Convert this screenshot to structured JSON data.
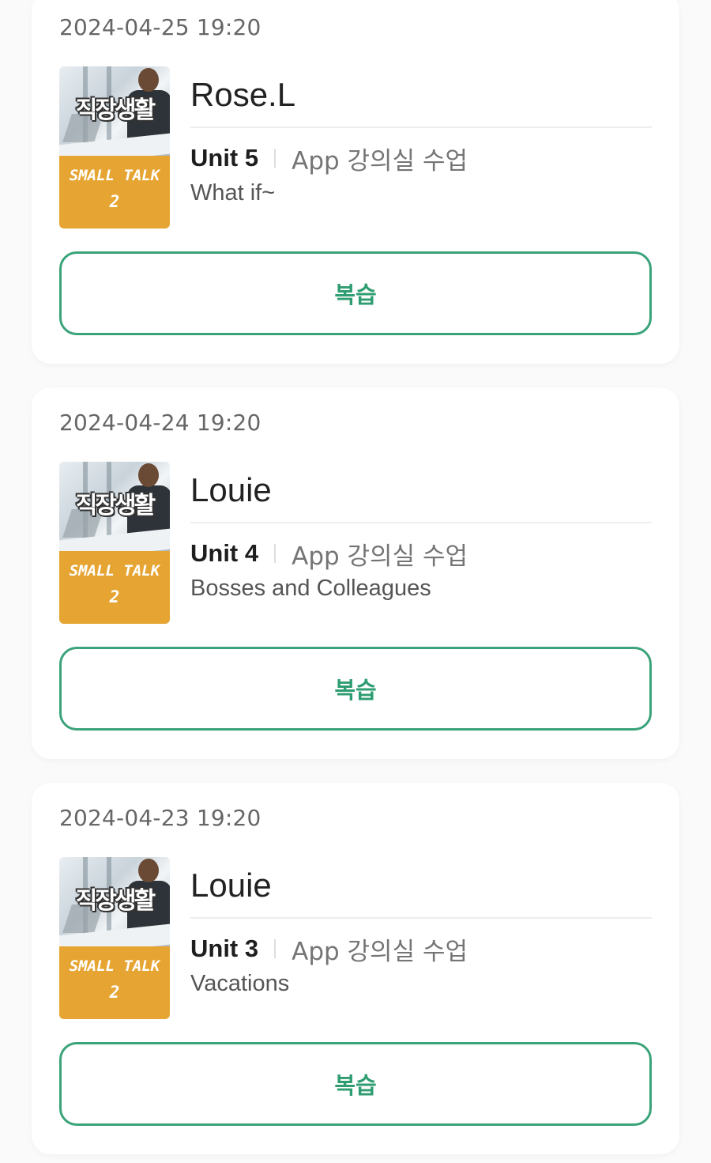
{
  "lessons": [
    {
      "date": "2024-04-25 19:20",
      "thumbnail": {
        "title": "직장생활",
        "subtitle": "SMALL TALK",
        "number": "2",
        "band_color": "#e6a533"
      },
      "tutor": "Rose.L",
      "unit": "Unit 5",
      "course_type": "App 강의실 수업",
      "lesson_title": "What if~",
      "review_label": "복습"
    },
    {
      "date": "2024-04-24 19:20",
      "thumbnail": {
        "title": "직장생활",
        "subtitle": "SMALL TALK",
        "number": "2",
        "band_color": "#e6a533"
      },
      "tutor": "Louie",
      "unit": "Unit 4",
      "course_type": "App 강의실 수업",
      "lesson_title": "Bosses and Colleagues",
      "review_label": "복습"
    },
    {
      "date": "2024-04-23 19:20",
      "thumbnail": {
        "title": "직장생활",
        "subtitle": "SMALL TALK",
        "number": "2",
        "band_color": "#e6a533"
      },
      "tutor": "Louie",
      "unit": "Unit 3",
      "course_type": "App 강의실 수업",
      "lesson_title": "Vacations",
      "review_label": "복습"
    }
  ],
  "colors": {
    "accent": "#2f9d72",
    "button_border": "#3aa37a",
    "card_background": "#ffffff",
    "page_background": "#fafafa"
  }
}
